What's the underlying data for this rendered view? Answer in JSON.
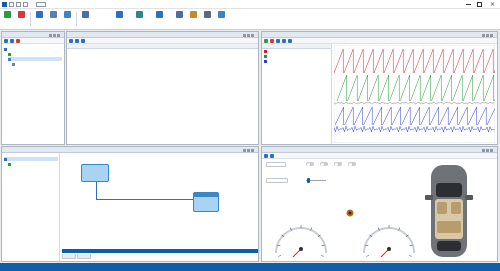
{
  "colors": {
    "accent": "#0e5ea9",
    "panel_header": "#e1e8f1",
    "node_fill": "#a9d3f2",
    "trace_red": "#d62020",
    "trace_green": "#1d9a36",
    "trace_blue": "#2a3fd0",
    "trace_gray": "#7a7a8a"
  },
  "titlebar": {
    "app_title": "",
    "link_text": ""
  },
  "ribbon": {
    "buttons": [
      {
        "label": "",
        "icon": "play-icon"
      },
      {
        "label": "",
        "icon": "stop-icon"
      },
      {
        "label": "",
        "icon": "grid-icon"
      },
      {
        "label": "",
        "icon": "document-icon"
      },
      {
        "label": "",
        "icon": "layout-icon"
      },
      {
        "label": "",
        "icon": "layers-icon"
      },
      {
        "label": "",
        "icon": "chart-icon"
      },
      {
        "label": "",
        "icon": "map-icon"
      },
      {
        "label": "",
        "icon": "export-icon"
      },
      {
        "label": "",
        "icon": "filter-icon"
      },
      {
        "label": "",
        "icon": "pencil-icon"
      },
      {
        "label": "",
        "icon": "wrench-icon"
      },
      {
        "label": "",
        "icon": "window-icon"
      }
    ],
    "right_text": ""
  },
  "panels": {
    "tree": {
      "title": "",
      "items": [
        "",
        "",
        "",
        ""
      ]
    },
    "message_list": {
      "title": "",
      "columns": [
        "",
        "",
        "",
        "",
        "",
        ""
      ],
      "rows": [
        [
          "",
          "",
          "",
          "",
          "",
          ""
        ],
        [
          "",
          "",
          "",
          "",
          "",
          ""
        ]
      ]
    },
    "trace": {
      "title": "",
      "signals": [
        {
          "name": "",
          "color": "#d62020"
        },
        {
          "name": "",
          "color": "#1d9a36"
        },
        {
          "name": "",
          "color": "#2a3fd0"
        }
      ],
      "x_ticks": [
        "",
        "",
        "",
        "",
        "",
        "",
        "",
        "",
        ""
      ]
    },
    "topology": {
      "title": "",
      "tree_items": [
        "",
        ""
      ],
      "node_a": {
        "line1": "",
        "line2": ""
      },
      "node_b": {
        "line1": "",
        "line2": ""
      },
      "bottom_tabs": [
        "",
        ""
      ]
    },
    "dashboard": {
      "title": "",
      "field_labels": [
        "",
        "",
        "",
        "",
        "",
        "",
        "",
        ""
      ],
      "input_values": [
        "",
        ""
      ],
      "section_labels": [
        "",
        ""
      ],
      "gauge_left": {
        "value": 0
      },
      "gauge_right": {
        "value": 0
      }
    }
  },
  "statusbar": {
    "left": "",
    "center": "",
    "right": ""
  }
}
